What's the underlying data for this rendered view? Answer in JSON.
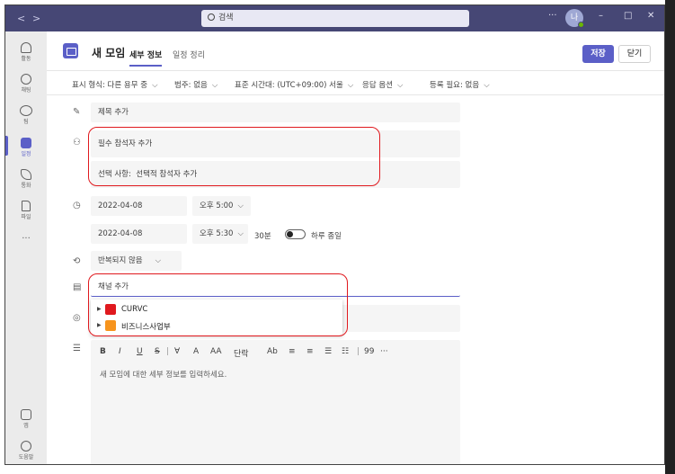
{
  "titlebar": {
    "back": "<",
    "forward": ">",
    "search_placeholder": "검색",
    "more": "···",
    "avatar_initial": "나",
    "minimize": "–",
    "maximize": "□",
    "close": "✕"
  },
  "rail": [
    {
      "label": "활동",
      "icon": "bell-icon"
    },
    {
      "label": "채팅",
      "icon": "chat-icon"
    },
    {
      "label": "팀",
      "icon": "teams-icon"
    },
    {
      "label": "일정",
      "icon": "calendar-icon",
      "active": true
    },
    {
      "label": "통화",
      "icon": "phone-icon"
    },
    {
      "label": "파일",
      "icon": "file-icon"
    },
    {
      "label": "···",
      "icon": "more-icon"
    },
    {
      "label": "앱",
      "icon": "apps-icon"
    },
    {
      "label": "도움말",
      "icon": "help-icon"
    }
  ],
  "header": {
    "title": "새 모임",
    "tabs": [
      "세부 정보",
      "일정 정리"
    ],
    "save": "저장",
    "close": "닫기"
  },
  "options": {
    "show_as": "표시 형식: 다른 용무 중",
    "category": "범주: 없음",
    "timezone": "표준 시간대: (UTC+09:00) 서울",
    "response": "응답 옵션",
    "registration": "등록 필요: 없음"
  },
  "form": {
    "title_placeholder": "제목 추가",
    "required_attendees": "필수 참석자 추가",
    "optional_label": "선택 사항:",
    "optional_placeholder": "선택적 참석자 추가",
    "start_date": "2022-04-08",
    "start_time": "오후 5:00",
    "end_date": "2022-04-08",
    "end_time": "오후 5:30",
    "duration": "30분",
    "all_day": "하루 종일",
    "repeat": "반복되지 않음",
    "channel_placeholder": "채널 추가",
    "channels": [
      {
        "name": "CURVC",
        "color": "#e0191e"
      },
      {
        "name": "비즈니스사업부",
        "color": "#f7941d"
      }
    ],
    "toolbar": [
      "B",
      "I",
      "U",
      "S",
      "|",
      "∀",
      "A",
      "AA",
      "단락",
      "Ab",
      "≡",
      "≡",
      "☰",
      "☷",
      "|",
      "99",
      "···"
    ],
    "details_placeholder": "새 모임에 대한 세부 정보를 입력하세요."
  },
  "colors": {
    "accent": "#5b5fc7",
    "titlebar": "#464775",
    "highlight": "#e0191e"
  }
}
